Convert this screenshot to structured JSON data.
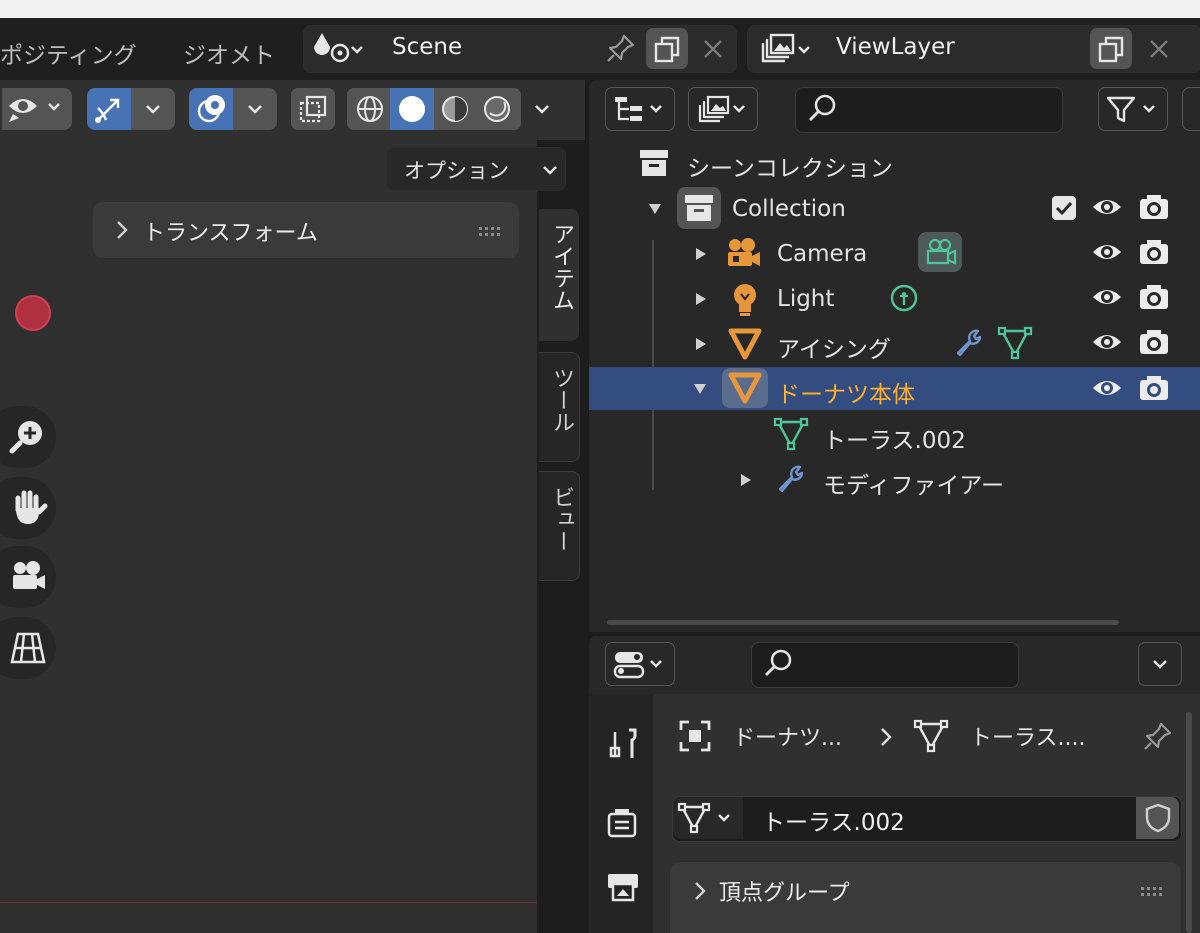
{
  "workspace_tabs": [
    "ポジティング",
    "ジオメト"
  ],
  "scene": {
    "name": "Scene"
  },
  "view_layer": {
    "name": "ViewLayer"
  },
  "viewport": {
    "options_label": "オプション",
    "transform_panel_label": "トランスフォーム",
    "sidebar_tabs": [
      "アイテム",
      "ツール",
      "ビュー"
    ]
  },
  "outliner": {
    "search_placeholder": "",
    "scene_collection_label": "シーンコレクション",
    "collection_label": "Collection",
    "items": [
      {
        "label": "Camera"
      },
      {
        "label": "Light"
      },
      {
        "label": "アイシング"
      },
      {
        "label": "ドーナツ本体",
        "selected": true
      },
      {
        "label": "トーラス.002"
      },
      {
        "label": "モディファイアー"
      }
    ]
  },
  "properties": {
    "search_placeholder": "",
    "breadcrumb_object": "ドーナツ...",
    "breadcrumb_mesh": "トーラス....",
    "mesh_name": "トーラス.002",
    "vertex_groups_label": "頂点グループ"
  },
  "colors": {
    "accent_blue": "#4772b3",
    "selected_row": "#334d80",
    "object_orange": "#e8963a",
    "data_green": "#4fc69a",
    "modifier_blue": "#6f95d0",
    "active_text": "#ffaf29"
  }
}
